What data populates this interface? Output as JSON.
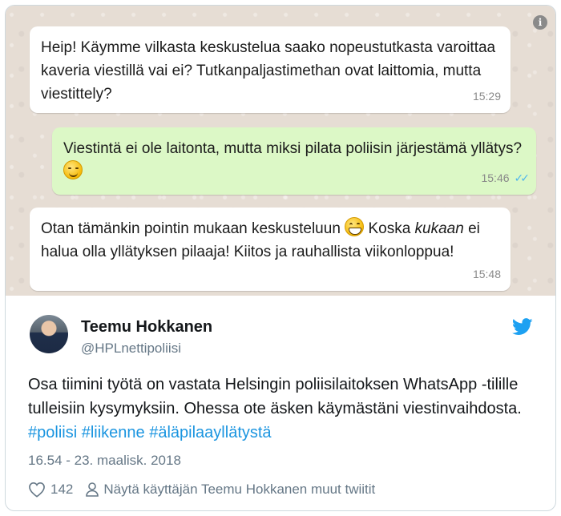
{
  "chat": {
    "messages": [
      {
        "direction": "in",
        "text": "Heip! Käymme vilkasta keskustelua saako nopeustutkasta varoittaa kaveria viestillä vai ei? Tutkanpaljastimethan ovat laittomia, mutta viestittely?",
        "time": "15:29"
      },
      {
        "direction": "out",
        "text_before": "Viestintä ei ole laitonta, mutta miksi pilata poliisin järjestämä yllätys?",
        "emoji": "smirking-face",
        "time": "15:46",
        "ticks": "✓✓"
      },
      {
        "direction": "in",
        "text_a": "Otan tämänkin pointin mukaan keskusteluun",
        "emoji": "grinning-face",
        "text_b": " Koska",
        "text_emph": "kukaan",
        "text_c": " ei halua olla yllätyksen pilaaja! Kiitos ja rauhallista viikonloppua!",
        "time": "15:48"
      }
    ]
  },
  "tweet": {
    "author_name": "Teemu Hokkanen",
    "author_handle": "@HPLnettipoliisi",
    "text": "Osa tiimini työtä on vastata Helsingin poliisilaitoksen WhatsApp -tilille tulleisiin kysymyksiin. Ohessa ote äsken käymästäni viestinvaihdosta.",
    "hashtags": [
      "#poliisi",
      "#liikenne",
      "#äläpilaayllätystä"
    ],
    "timestamp": "16.54 - 23. maalisk. 2018",
    "like_count": "142",
    "more_tweets_label": "Näytä käyttäjän Teemu Hokkanen muut twiitit"
  },
  "colors": {
    "chat_bg": "#e6ddd4",
    "outgoing_bubble": "#dcf8c6",
    "hashtag": "#1b95e0",
    "twitter_blue": "#1da1f2"
  }
}
